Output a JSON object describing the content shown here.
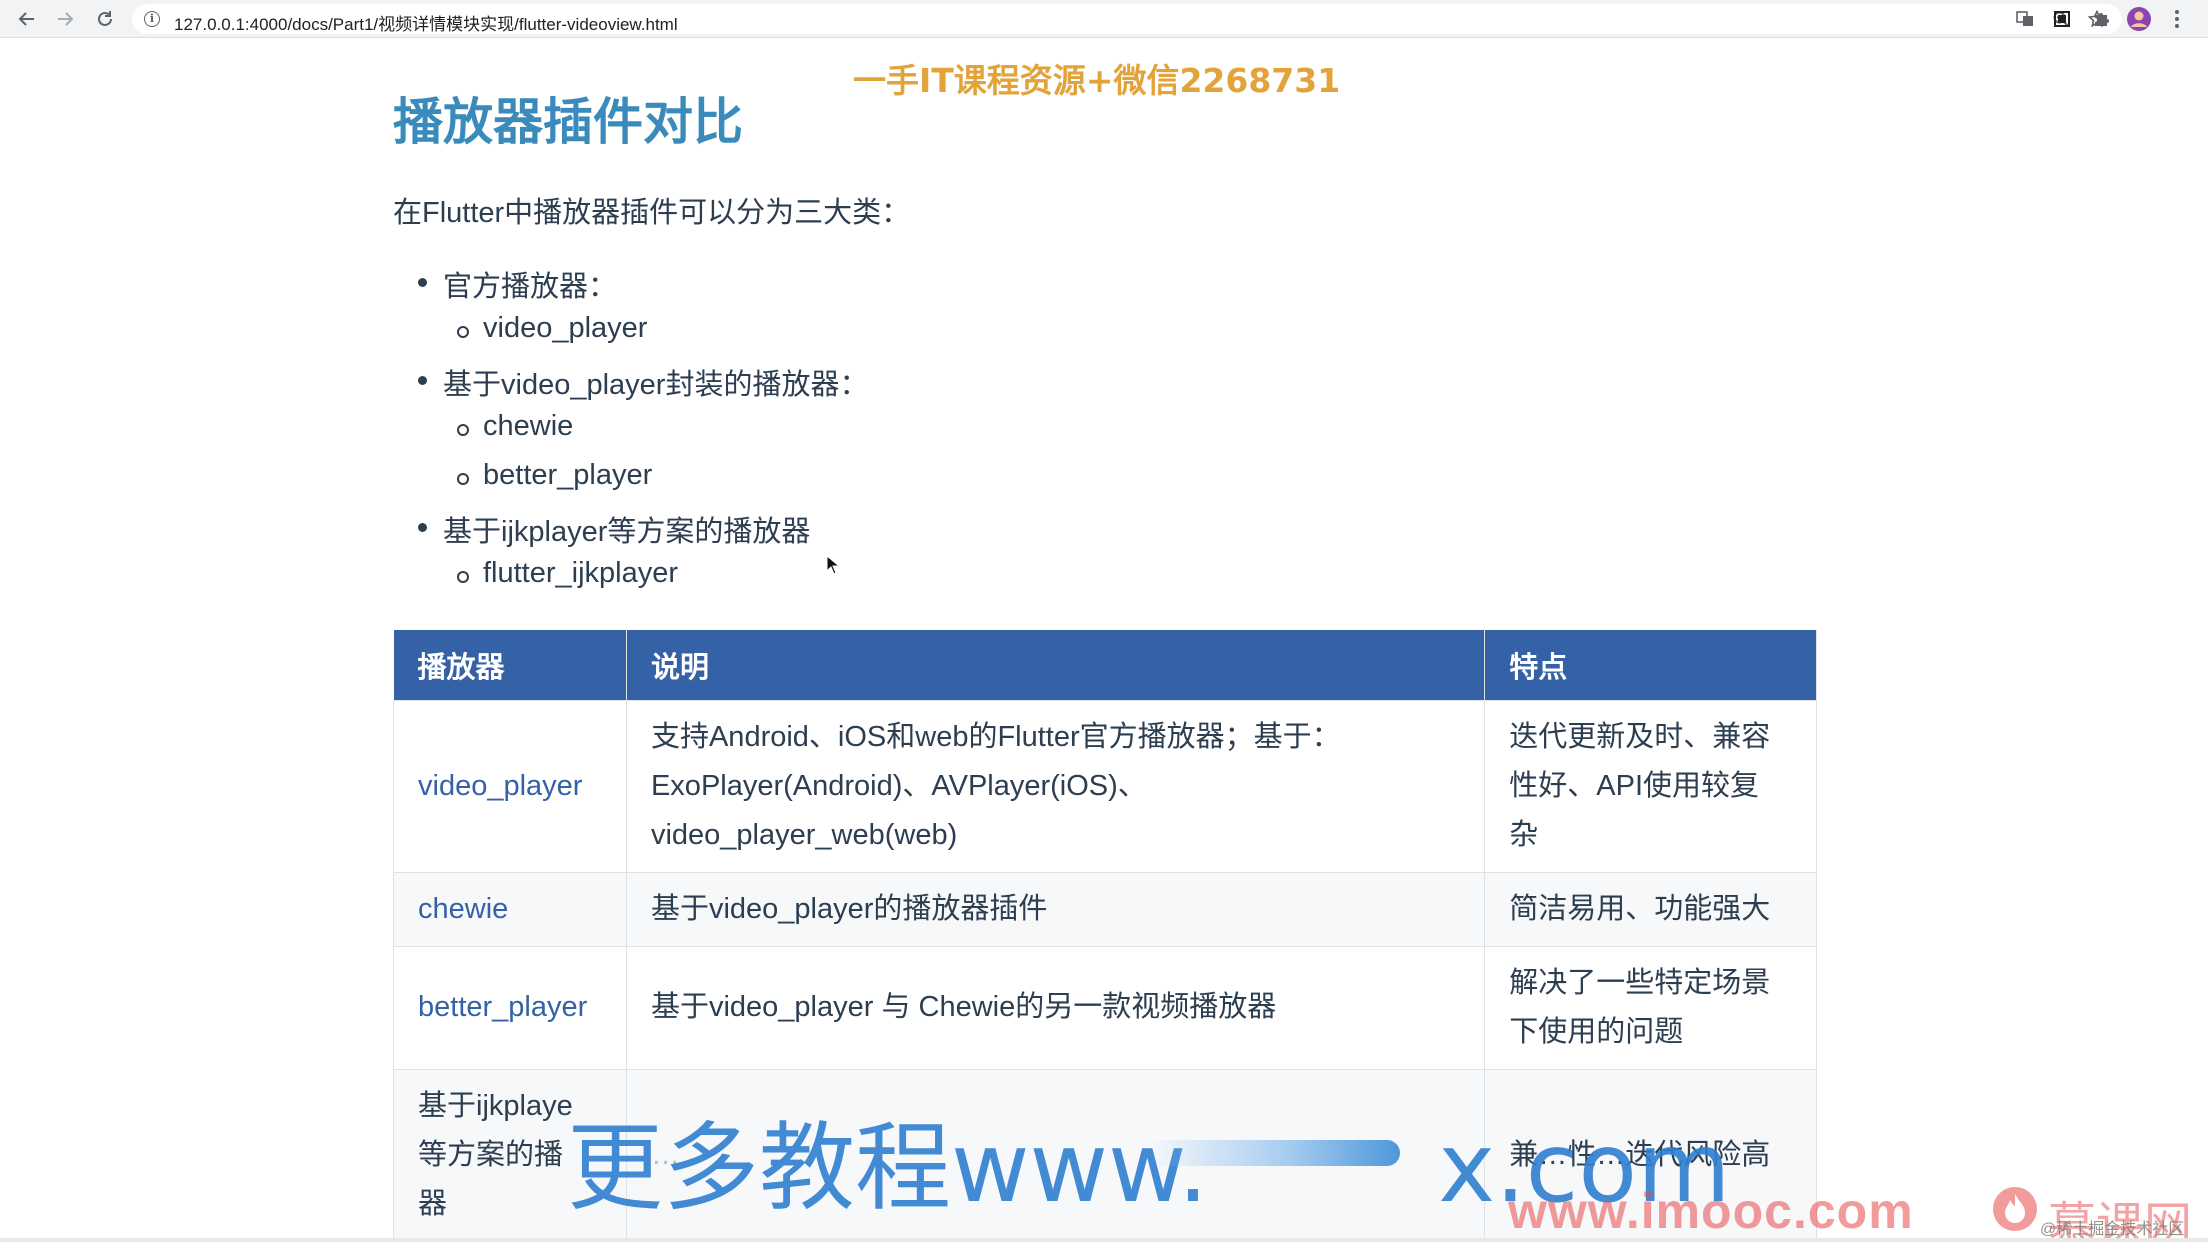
{
  "browser": {
    "url": "127.0.0.1:4000/docs/Part1/视频详情模块实现/flutter-videoview.html"
  },
  "page": {
    "title": "播放器插件对比",
    "intro": "在Flutter中播放器插件可以分为三大类：",
    "categories": [
      {
        "label": "官方播放器：",
        "items": [
          "video_player"
        ]
      },
      {
        "label": "基于video_player封装的播放器：",
        "items": [
          "chewie",
          "better_player"
        ]
      },
      {
        "label": "基于ijkplayer等方案的播放器",
        "items": [
          "flutter_ijkplayer"
        ]
      }
    ]
  },
  "table": {
    "headers": [
      "播放器",
      "说明",
      "特点"
    ],
    "rows": [
      {
        "player": "video_player",
        "desc": [
          "支持Android、iOS和web的Flutter官方播放器；基于：",
          "ExoPlayer(Android)、AVPlayer(iOS)、",
          "video_player_web(web)"
        ],
        "features": [
          "迭代更新及时、兼容",
          "性好、API使用较复",
          "杂"
        ]
      },
      {
        "player": "chewie",
        "desc": [
          "基于video_player的播放器插件"
        ],
        "features": [
          "简洁易用、功能强大"
        ]
      },
      {
        "player": "better_player",
        "desc": [
          "基于video_player 与 Chewie的另一款视频播放器"
        ],
        "features": [
          "解决了一些特定场景",
          "下使用的问题"
        ]
      },
      {
        "player": [
          "基于ijkplaye",
          "等方案的播",
          "器"
        ],
        "desc": [
          "…"
        ],
        "features": [
          "兼…性…迭代风险高"
        ]
      }
    ]
  },
  "watermarks": {
    "top": "一手IT课程资源+微信2268731",
    "big": "更多教程www.",
    "big_suffix": "x.com",
    "imooc": "www.imooc.com",
    "brand": "慕课网",
    "small": "@稀土掘金技术社区"
  },
  "colors": {
    "title": "#3a8bbb",
    "header_bg": "#3561a6",
    "link": "#3561a6",
    "text": "#2c3e50"
  }
}
